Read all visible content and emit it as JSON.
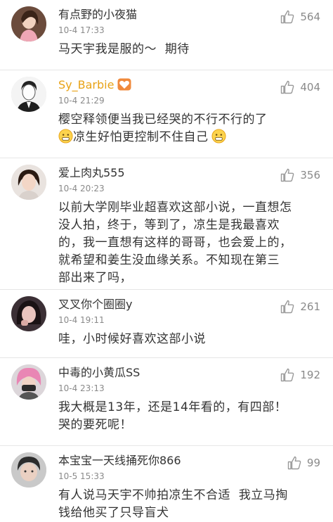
{
  "comments": [
    {
      "username": "有点野的小夜猫",
      "time": "10-4 17:33",
      "likes": "564",
      "lines": [
        "马天宇我是服的～  期待"
      ],
      "avatar_icon": "avatar-woman-pink-top"
    },
    {
      "username": "Sy_Barbie",
      "username_color": "#e8a317",
      "badge_icon": "vip-heart-badge-icon",
      "time": "10-4 21:29",
      "likes": "404",
      "lines": [
        "樱空释领便当我已经哭的不行不行的了",
        "凉生好怕更控制不住自己"
      ],
      "avatar_icon": "avatar-sketch-man-suit"
    },
    {
      "username": "爱上肉丸555",
      "time": "10-4 20:23",
      "likes": "356",
      "lines": [
        "以前大学刚毕业超喜欢这部小说，一直想怎",
        "没人拍，终于，等到了，凉生是我最喜欢",
        "的，我一直想有这样的哥哥，也会爱上的，",
        "就希望和姜生没血缘关系。不知现在第三",
        "部出来了吗，"
      ],
      "avatar_icon": "avatar-woman-dark-hair"
    },
    {
      "username": "叉叉你个圈圈y",
      "time": "10-4 19:11",
      "likes": "261",
      "lines": [
        "哇，小时候好喜欢这部小说"
      ],
      "avatar_icon": "avatar-girl-hand-on-face"
    },
    {
      "username": "中毒的小黄瓜SS",
      "time": "10-4 23:13",
      "likes": "192",
      "lines": [
        "我大概是13年，还是14年看的，有四部！",
        "哭的要死呢！"
      ],
      "avatar_icon": "avatar-pink-hair-masked"
    },
    {
      "username": "本宝宝一天线捅死你866",
      "time": "10-5 15:33",
      "likes": "99",
      "lines": [
        "有人说马天宇不帅拍凉生不合适  我立马掏",
        "钱给他买了只导盲犬"
      ],
      "avatar_icon": "avatar-child-face"
    }
  ],
  "icons": {
    "like": "thumbs-up-icon",
    "emoji": "grimace-emoji-icon"
  }
}
